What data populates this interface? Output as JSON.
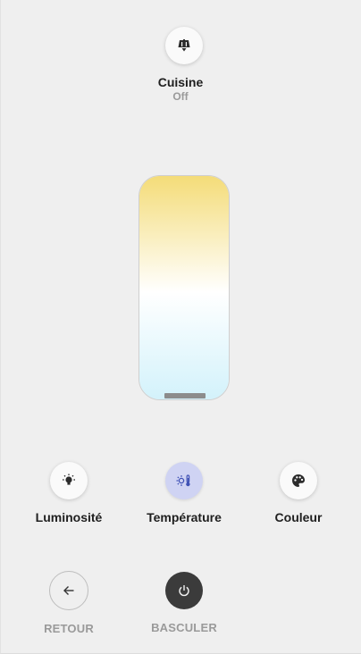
{
  "entity": {
    "name": "Cuisine",
    "state": "Off",
    "icon": "ceiling-light-icon"
  },
  "temperature_slider": {
    "gradient_colors": [
      "#f4dc78",
      "#ffffff",
      "#d3f2fb"
    ],
    "handle_color": "#8c8c8c",
    "value_fraction": 0.0
  },
  "modes": {
    "brightness": {
      "label": "Luminosité",
      "icon": "lightbulb-icon"
    },
    "temperature": {
      "label": "Température",
      "icon": "thermometer-sun-icon",
      "active": true,
      "active_bg": "#cfd3f3",
      "icon_color": "#3f51b5"
    },
    "color": {
      "label": "Couleur",
      "icon": "palette-icon"
    }
  },
  "actions": {
    "back": {
      "label": "RETOUR",
      "icon": "arrow-left-icon"
    },
    "toggle": {
      "label": "BASCULER",
      "icon": "power-icon"
    }
  }
}
